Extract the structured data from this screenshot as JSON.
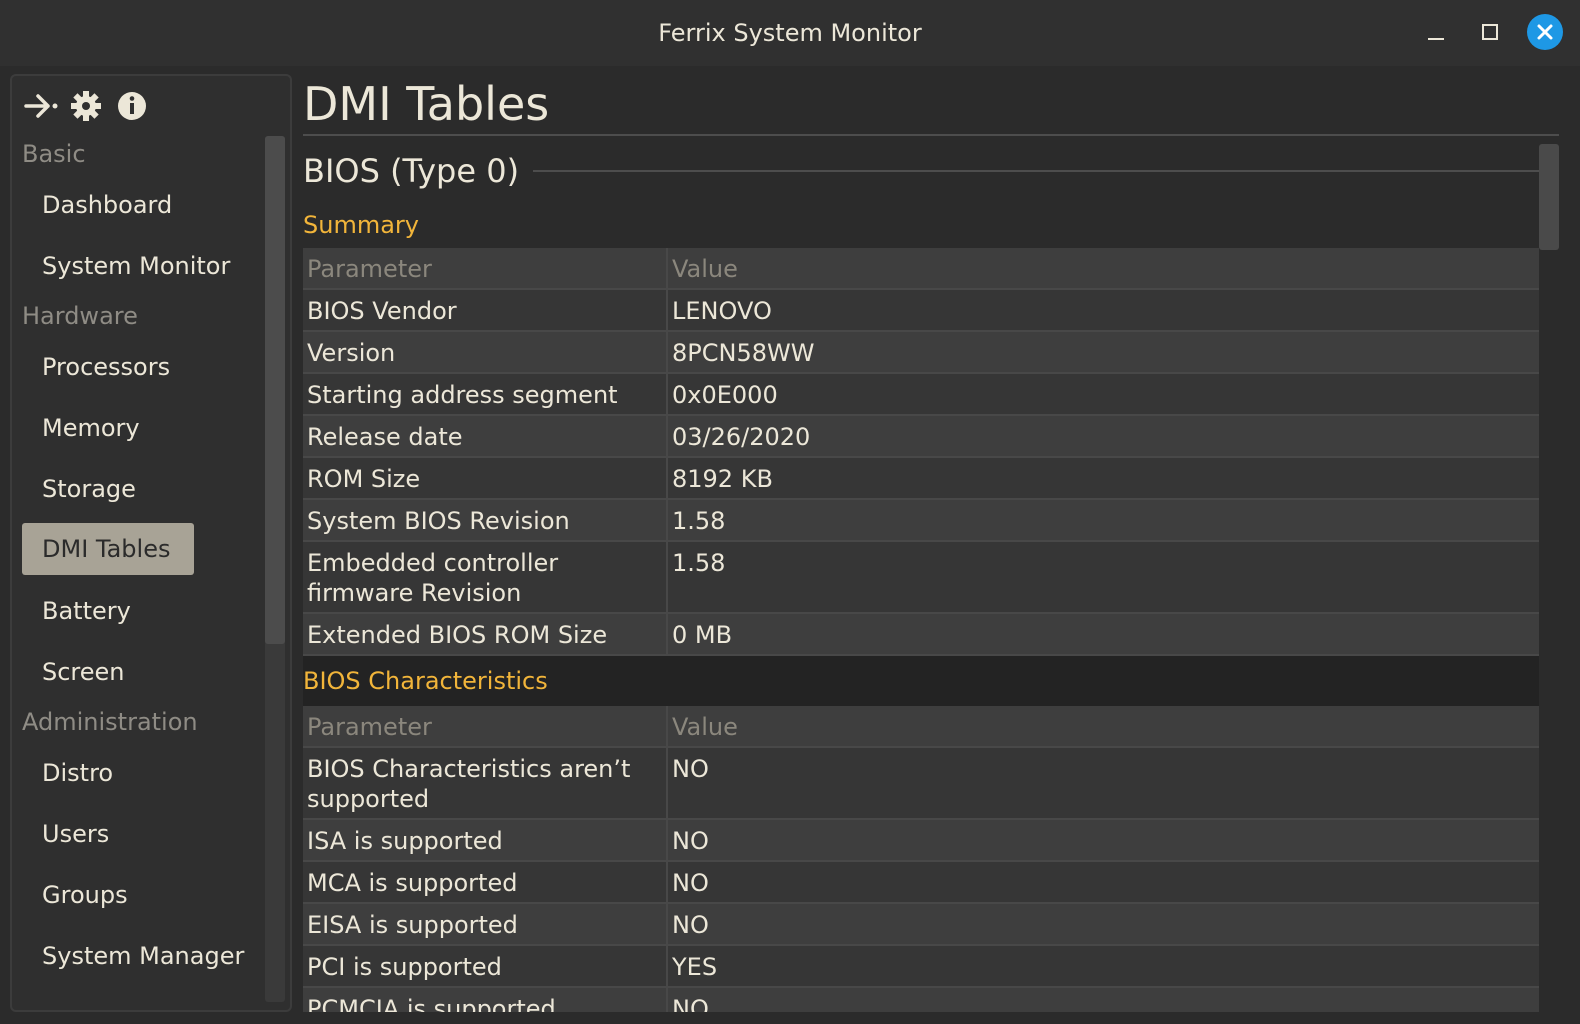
{
  "window": {
    "title": "Ferrix System Monitor"
  },
  "sidebar": {
    "toolbar_icons": [
      "collapse-arrow-icon",
      "gear-icon",
      "info-icon"
    ],
    "sections": [
      {
        "label": "Basic",
        "items": [
          {
            "label": "Dashboard",
            "active": false
          },
          {
            "label": "System Monitor",
            "active": false
          }
        ]
      },
      {
        "label": "Hardware",
        "items": [
          {
            "label": "Processors",
            "active": false
          },
          {
            "label": "Memory",
            "active": false
          },
          {
            "label": "Storage",
            "active": false
          },
          {
            "label": "DMI Tables",
            "active": true
          },
          {
            "label": "Battery",
            "active": false
          },
          {
            "label": "Screen",
            "active": false
          }
        ]
      },
      {
        "label": "Administration",
        "items": [
          {
            "label": "Distro",
            "active": false
          },
          {
            "label": "Users",
            "active": false
          },
          {
            "label": "Groups",
            "active": false
          },
          {
            "label": "System Manager",
            "active": false
          }
        ]
      }
    ]
  },
  "main": {
    "page_title": "DMI Tables",
    "group_title": "BIOS (Type 0)",
    "summary": {
      "heading": "Summary",
      "col_param": "Parameter",
      "col_value": "Value",
      "rows": [
        {
          "param": "BIOS Vendor",
          "value": "LENOVO"
        },
        {
          "param": "Version",
          "value": "8PCN58WW"
        },
        {
          "param": "Starting address segment",
          "value": "0x0E000"
        },
        {
          "param": "Release date",
          "value": "03/26/2020"
        },
        {
          "param": "ROM Size",
          "value": "8192 KB"
        },
        {
          "param": "System BIOS Revision",
          "value": "1.58"
        },
        {
          "param": "Embedded controller firmware Revision",
          "value": "1.58"
        },
        {
          "param": "Extended BIOS ROM Size",
          "value": "0 MB"
        }
      ]
    },
    "characteristics": {
      "heading": "BIOS Characteristics",
      "col_param": "Parameter",
      "col_value": "Value",
      "rows": [
        {
          "param": "BIOS Characteristics aren’t supported",
          "value": "NO"
        },
        {
          "param": "ISA is supported",
          "value": "NO"
        },
        {
          "param": "MCA is supported",
          "value": "NO"
        },
        {
          "param": "EISA is supported",
          "value": "NO"
        },
        {
          "param": "PCI is supported",
          "value": "YES"
        },
        {
          "param": "PCMCIA is supported",
          "value": "NO"
        }
      ]
    }
  },
  "colors": {
    "accent_heading": "#f2b53a",
    "close_button": "#1e98e5",
    "active_item_bg": "#a8a396"
  }
}
